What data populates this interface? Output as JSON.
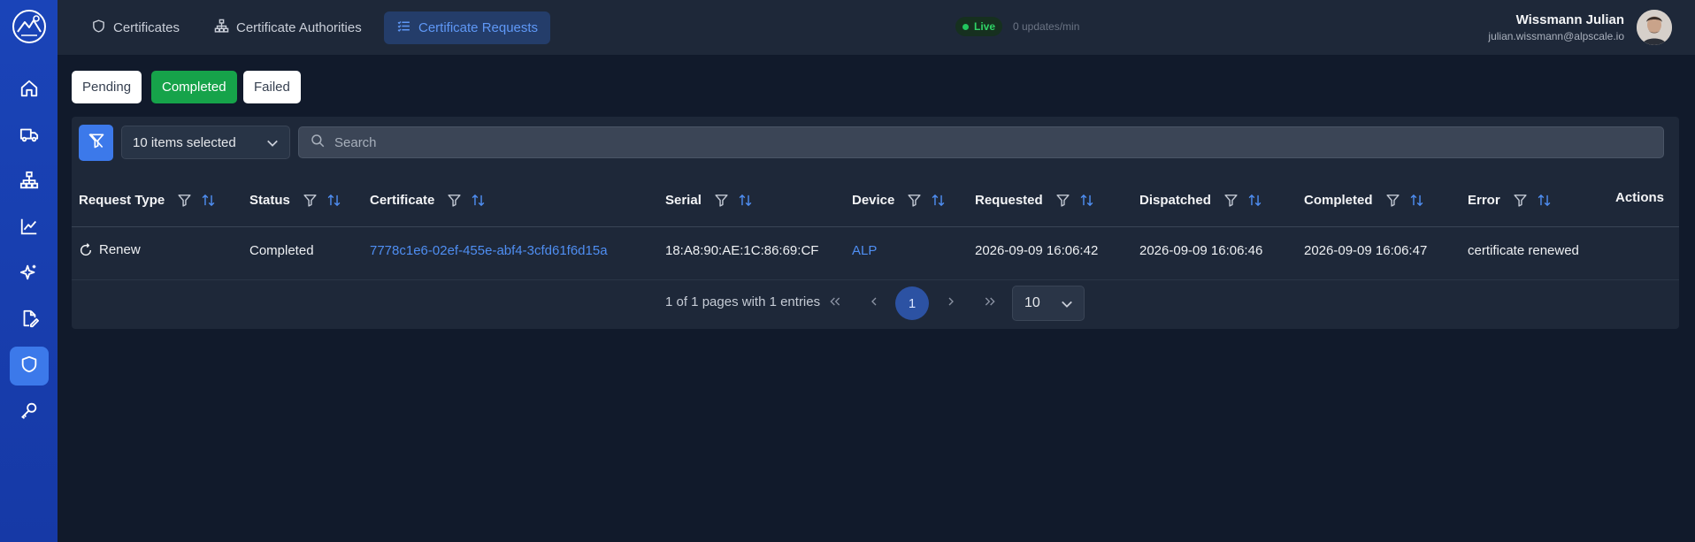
{
  "colors": {
    "sidebar": "#1a44b8",
    "accent": "#3c79ea",
    "success": "#16a34a",
    "link": "#4f8ef2",
    "background": "#111a2b",
    "panel": "#1e2839"
  },
  "sidebar": {
    "items": [
      "home-icon",
      "truck-icon",
      "sitemap-icon",
      "chart-icon",
      "sparkles-icon",
      "file-edit-icon",
      "shield-icon",
      "key-icon"
    ],
    "active": "shield-icon"
  },
  "tabs": [
    {
      "label": "Certificates",
      "icon": "shield-icon"
    },
    {
      "label": "Certificate Authorities",
      "icon": "sitemap-icon"
    },
    {
      "label": "Certificate Requests",
      "icon": "list-icon",
      "active": true
    }
  ],
  "status": {
    "live": "Live",
    "updates": "0 updates/min"
  },
  "user": {
    "name": "Wissmann Julian",
    "email": "julian.wissmann@alpscale.io"
  },
  "filters": {
    "pending": "Pending",
    "completed": "Completed",
    "failed": "Failed",
    "active": "Completed"
  },
  "toolbar": {
    "selected": "10 items selected",
    "search_placeholder": "Search"
  },
  "table": {
    "columns": [
      "Request Type",
      "Status",
      "Certificate",
      "Serial",
      "Device",
      "Requested",
      "Dispatched",
      "Completed",
      "Error",
      "Actions"
    ],
    "rows": [
      {
        "request_type": "Renew",
        "status": "Completed",
        "certificate": "7778c1e6-02ef-455e-abf4-3cfd61f6d15a",
        "serial": "18:A8:90:AE:1C:86:69:CF",
        "device": "ALP",
        "requested": "2026-09-09 16:06:42",
        "dispatched": "2026-09-09 16:06:46",
        "completed": "2026-09-09 16:06:47",
        "error": "certificate renewed"
      }
    ]
  },
  "pagination": {
    "summary": "1 of 1 pages with 1 entries",
    "current_page": "1",
    "rows_per_page": "10"
  }
}
